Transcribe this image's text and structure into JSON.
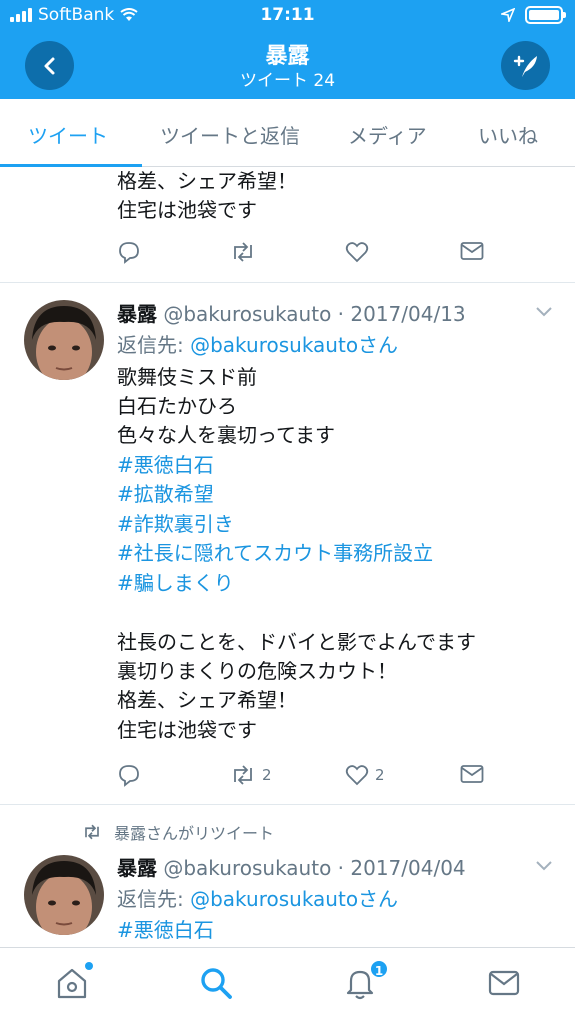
{
  "status_bar": {
    "carrier": "SoftBank",
    "time": "17:11"
  },
  "header": {
    "title": "暴露",
    "subtitle": "ツイート 24"
  },
  "tabs": [
    {
      "label": "ツイート",
      "active": true
    },
    {
      "label": "ツイートと返信"
    },
    {
      "label": "メディア"
    },
    {
      "label": "いいね"
    }
  ],
  "tweet0": {
    "lines": [
      "格差、シェア希望！",
      "住宅は池袋です"
    ]
  },
  "tweet1": {
    "name": "暴露",
    "handle": "@bakurosukauto · 2017/04/13",
    "reply_prefix": "返信先: ",
    "reply_to": "@bakurosukautoさん",
    "lines": [
      "歌舞伎ミスド前",
      "白石たかひろ",
      "色々な人を裏切ってます"
    ],
    "hashtags": [
      "#悪徳白石",
      "#拡散希望",
      "#詐欺裏引き",
      "#社長に隠れてスカウト事務所設立",
      "#騙しまくり"
    ],
    "lines2": [
      "社長のことを、ドバイと影でよんでます",
      "裏切りまくりの危険スカウト！",
      "格差、シェア希望！",
      "住宅は池袋です"
    ],
    "retweets": "2",
    "likes": "2"
  },
  "retweet_label": "暴露さんがリツイート",
  "tweet2": {
    "name": "暴露",
    "handle": "@bakurosukauto · 2017/04/04",
    "reply_prefix": "返信先: ",
    "reply_to": "@bakurosukautoさん",
    "hashtag": "#悪徳白石"
  },
  "bottom_nav": {
    "notifications_badge": "1"
  },
  "colors": {
    "brand": "#1da1f2",
    "link": "#1b95e0",
    "muted": "#657786"
  }
}
